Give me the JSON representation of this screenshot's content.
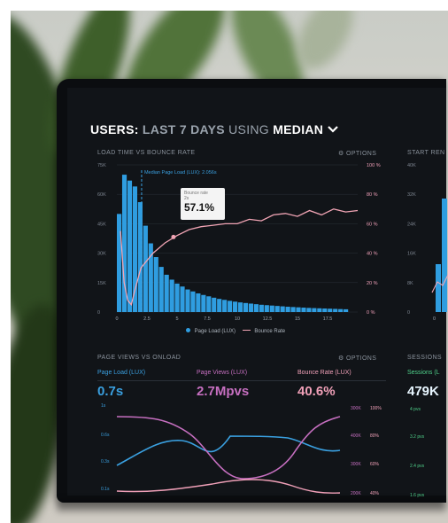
{
  "dashboard": {
    "title_prefix": "USERS:",
    "title_range": "LAST 7 DAYS",
    "title_using": "USING",
    "title_stat": "MEDIAN",
    "chevron_icon": "chevron-down-icon"
  },
  "top_chart": {
    "label": "LOAD TIME VS BOUNCE RATE",
    "options": "⚙ OPTIONS",
    "median_annotation": "Median Page Load (LUX): 2.056s",
    "tooltip_lines": [
      "Bounce rate",
      "2s"
    ],
    "tooltip_value": "57.1%",
    "legend_page_load": "Page Load (LUX)",
    "legend_bounce": "Bounce Rate"
  },
  "side_chart": {
    "label": "START REN"
  },
  "bottom_chart": {
    "label": "PAGE VIEWS VS ONLOAD",
    "options": "⚙ OPTIONS",
    "left_ticks": [
      "1s",
      "0.6s",
      "0.3s",
      "0.1s"
    ],
    "right_ticks_a": [
      "300K",
      "400K",
      "300K",
      "200K"
    ],
    "right_ticks_b": [
      "100%",
      "80%",
      "60%",
      "40%"
    ]
  },
  "sessions": {
    "label": "SESSIONS",
    "metric_label": "Sessions (L",
    "value": "479K",
    "ticks": [
      "4 pvs",
      "3.2 pvs",
      "2.4 pvs",
      "1.6 pvs"
    ]
  },
  "metrics": [
    {
      "label": "Page Load (LUX)",
      "value": "0.7s",
      "color": "#3aa0e0"
    },
    {
      "label": "Page Views (LUX)",
      "value": "2.7Mpvs",
      "color": "#c66fc0"
    },
    {
      "label": "Bounce Rate (LUX)",
      "value": "40.6%",
      "color": "#f0a0b8"
    }
  ],
  "chart_data": {
    "type": "bar",
    "x_ticks": [
      "0",
      "2.5",
      "5",
      "7.5",
      "10",
      "12.5",
      "15",
      "17.5"
    ],
    "y_left_ticks": [
      "75K",
      "60K",
      "45K",
      "30K",
      "15K",
      "0"
    ],
    "y_right_ticks": [
      "100 %",
      "80 %",
      "60 %",
      "40 %",
      "20 %",
      "0 %"
    ],
    "side_y_ticks": [
      "40K",
      "32K",
      "24K",
      "16K",
      "8K",
      "0"
    ],
    "ylim": [
      0,
      75000
    ],
    "bar_values": [
      50000,
      70000,
      67000,
      64000,
      56000,
      44000,
      35000,
      28000,
      23000,
      19000,
      16500,
      14500,
      13000,
      11500,
      10500,
      9500,
      8700,
      8000,
      7300,
      6700,
      6200,
      5700,
      5300,
      4900,
      4600,
      4300,
      4000,
      3700,
      3500,
      3300,
      3100,
      2900,
      2700,
      2550,
      2400,
      2250,
      2100,
      2000,
      1900,
      1800,
      1700,
      1600,
      1500,
      1400
    ],
    "bounce_rate": [
      [
        0.3,
        55
      ],
      [
        0.6,
        20
      ],
      [
        0.9,
        8
      ],
      [
        1.2,
        5
      ],
      [
        1.5,
        15
      ],
      [
        2.0,
        30
      ],
      [
        3,
        40
      ],
      [
        4,
        47
      ],
      [
        5,
        52
      ],
      [
        6,
        56
      ],
      [
        7,
        58
      ],
      [
        8,
        59
      ],
      [
        9,
        60
      ],
      [
        10,
        60
      ],
      [
        11,
        63
      ],
      [
        12,
        62
      ],
      [
        13,
        66
      ],
      [
        14,
        67
      ],
      [
        15,
        65
      ],
      [
        16,
        69
      ],
      [
        17,
        66
      ],
      [
        18,
        70
      ],
      [
        19,
        68
      ],
      [
        20,
        69
      ]
    ],
    "median_x": 2.056
  }
}
